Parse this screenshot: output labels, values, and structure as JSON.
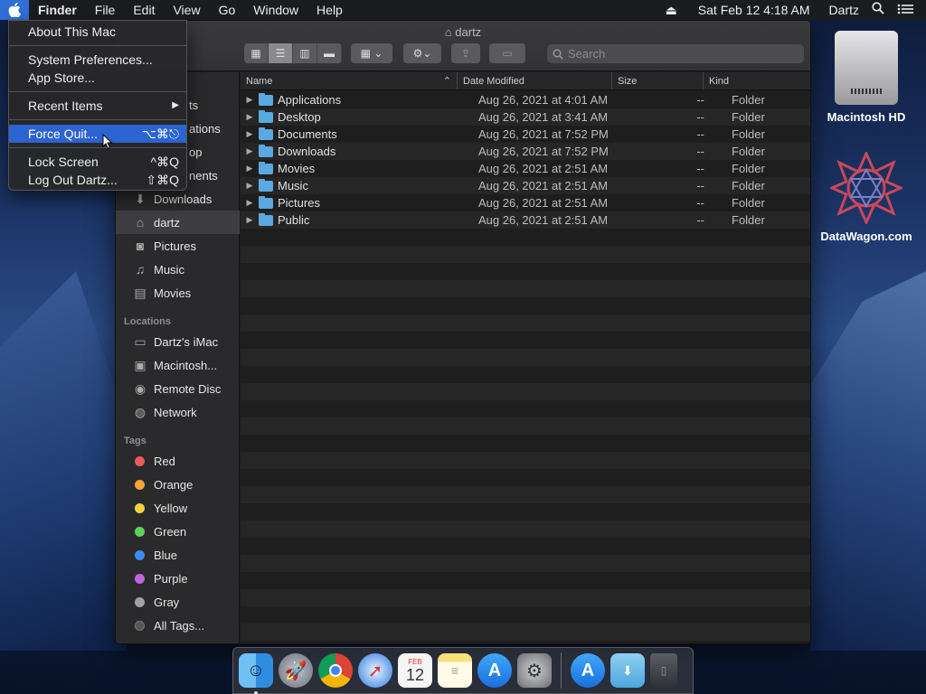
{
  "menubar": {
    "app": "Finder",
    "items": [
      "File",
      "Edit",
      "View",
      "Go",
      "Window",
      "Help"
    ],
    "datetime": "Sat Feb 12  4:18 AM",
    "user": "Dartz"
  },
  "apple_menu": {
    "about": "About This Mac",
    "system_prefs": "System Preferences...",
    "app_store": "App Store...",
    "recent": "Recent Items",
    "force_quit": "Force Quit...",
    "force_quit_shortcut": "⌥⌘⎋",
    "lock": "Lock Screen",
    "lock_shortcut": "^⌘Q",
    "logout": "Log Out Dartz...",
    "logout_shortcut": "⇧⌘Q"
  },
  "window": {
    "title": "dartz",
    "search_placeholder": "Search"
  },
  "sidebar": {
    "partial": [
      "ts",
      "ations",
      "op",
      "nents"
    ],
    "downloads": "Downloads",
    "home": "dartz",
    "pictures": "Pictures",
    "music": "Music",
    "movies": "Movies",
    "locations_head": "Locations",
    "imac": "Dartz's iMac",
    "hd": "Macintosh...",
    "remote": "Remote Disc",
    "network": "Network",
    "tags_head": "Tags",
    "tags": [
      {
        "name": "Red",
        "color": "#ec5b57"
      },
      {
        "name": "Orange",
        "color": "#f5a33b"
      },
      {
        "name": "Yellow",
        "color": "#f4d23c"
      },
      {
        "name": "Green",
        "color": "#5cd35b"
      },
      {
        "name": "Blue",
        "color": "#3d8ef2"
      },
      {
        "name": "Purple",
        "color": "#c163de"
      },
      {
        "name": "Gray",
        "color": "#a0a0a4"
      }
    ],
    "all_tags": "All Tags..."
  },
  "list": {
    "headers": {
      "name": "Name",
      "date": "Date Modified",
      "size": "Size",
      "kind": "Kind"
    },
    "rows": [
      {
        "name": "Applications",
        "date": "Aug 26, 2021 at 4:01 AM",
        "size": "--",
        "kind": "Folder"
      },
      {
        "name": "Desktop",
        "date": "Aug 26, 2021 at 3:41 AM",
        "size": "--",
        "kind": "Folder"
      },
      {
        "name": "Documents",
        "date": "Aug 26, 2021 at 7:52 PM",
        "size": "--",
        "kind": "Folder"
      },
      {
        "name": "Downloads",
        "date": "Aug 26, 2021 at 7:52 PM",
        "size": "--",
        "kind": "Folder"
      },
      {
        "name": "Movies",
        "date": "Aug 26, 2021 at 2:51 AM",
        "size": "--",
        "kind": "Folder"
      },
      {
        "name": "Music",
        "date": "Aug 26, 2021 at 2:51 AM",
        "size": "--",
        "kind": "Folder"
      },
      {
        "name": "Pictures",
        "date": "Aug 26, 2021 at 2:51 AM",
        "size": "--",
        "kind": "Folder"
      },
      {
        "name": "Public",
        "date": "Aug 26, 2021 at 2:51 AM",
        "size": "--",
        "kind": "Folder"
      }
    ]
  },
  "desktop": {
    "hd_label": "Macintosh HD",
    "site_label": "DataWagon.com"
  },
  "dock": {
    "calendar_month": "FEB",
    "calendar_day": "12"
  }
}
